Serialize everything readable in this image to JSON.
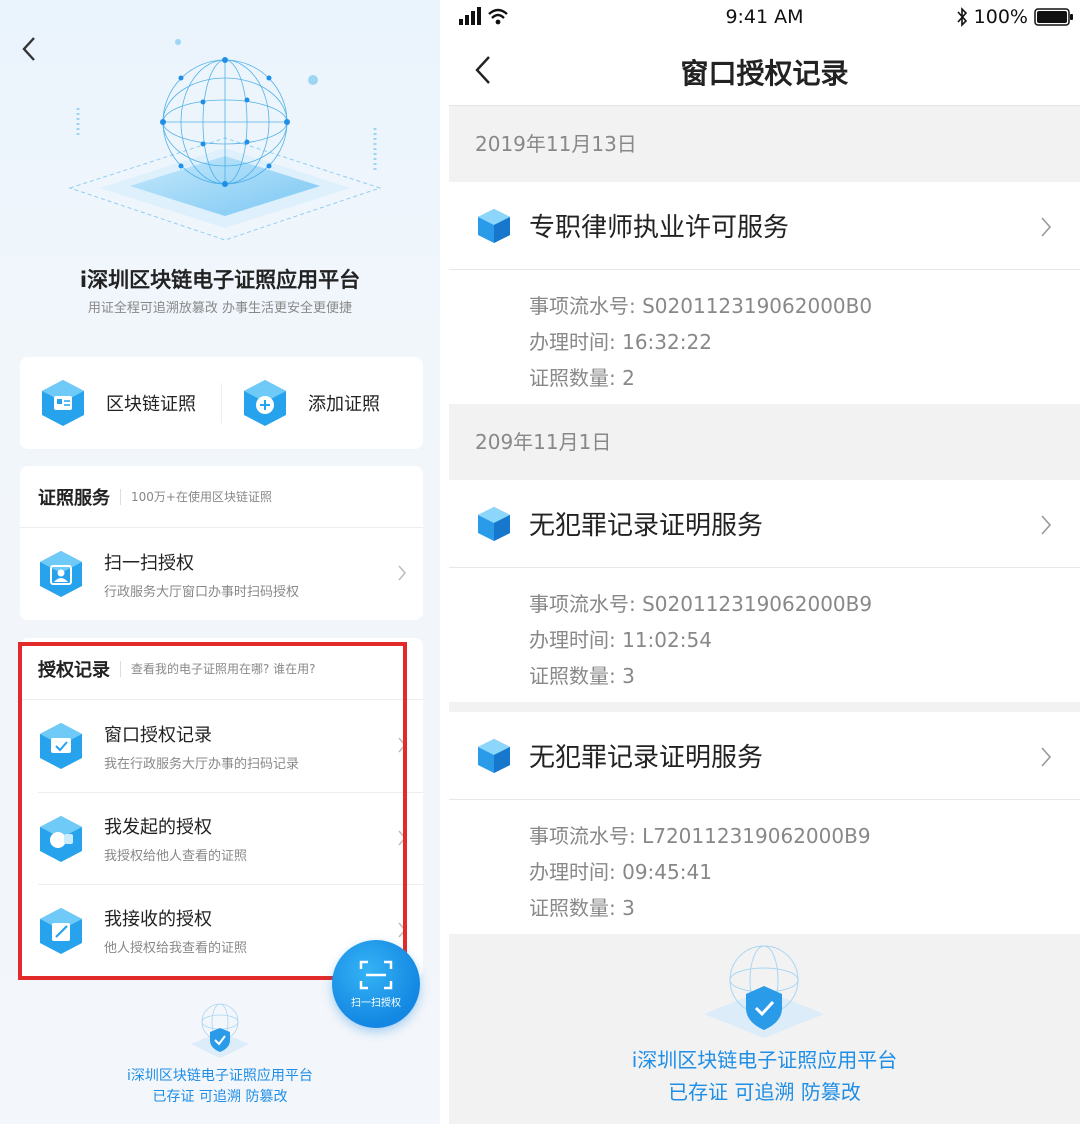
{
  "left": {
    "hero_title": "i深圳区块链电子证照应用平台",
    "hero_subtitle": "用证全程可追溯放篡改  办事生活更安全更便捷",
    "quick": [
      {
        "label": "区块链证照",
        "icon": "blockchain-license-icon"
      },
      {
        "label": "添加证照",
        "icon": "add-license-icon"
      }
    ],
    "service": {
      "heading": "证照服务",
      "desc": "100万+在使用区块链证照",
      "item": {
        "title": "扫一扫授权",
        "subtitle": "行政服务大厅窗口办事时扫码授权"
      }
    },
    "auth": {
      "heading": "授权记录",
      "desc": "查看我的电子证照用在哪? 谁在用?",
      "items": [
        {
          "title": "窗口授权记录",
          "subtitle": "我在行政服务大厅办事的扫码记录"
        },
        {
          "title": "我发起的授权",
          "subtitle": "我授权给他人查看的证照"
        },
        {
          "title": "我接收的授权",
          "subtitle": "他人授权给我查看的证照"
        }
      ]
    },
    "fab_label": "扫一扫授权",
    "footer": {
      "line1": "i深圳区块链电子证照应用平台",
      "line2": "已存证 可追溯 防篡改"
    }
  },
  "right": {
    "status": {
      "time": "9:41 AM",
      "battery": "100%"
    },
    "title": "窗口授权记录",
    "dates": [
      "2019年11月13日",
      "209年11月1日"
    ],
    "records": [
      {
        "name": "专职律师执业许可服务",
        "serial": "事项流水号:  S020112319062000B0",
        "time": "办理时间:  16:32:22",
        "count": "证照数量:  2"
      },
      {
        "name": "无犯罪记录证明服务",
        "serial": "事项流水号:  S020112319062000B9",
        "time": "办理时间:  11:02:54",
        "count": "证照数量:  3"
      },
      {
        "name": "无犯罪记录证明服务",
        "serial": "事项流水号:  L720112319062000B9",
        "time": "办理时间:  09:45:41",
        "count": "证照数量:  3"
      }
    ],
    "footer": {
      "line1": "i深圳区块链电子证照应用平台",
      "line2": "已存证 可追溯 防篡改"
    }
  },
  "colors": {
    "accent": "#1f8ee6",
    "highlight": "#e32a2a"
  }
}
